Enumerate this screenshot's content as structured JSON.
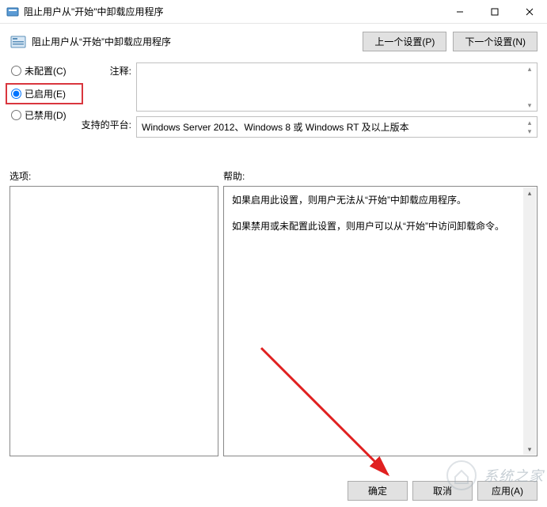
{
  "window": {
    "title": "阻止用户从\"开始\"中卸载应用程序"
  },
  "header": {
    "title": "阻止用户从“开始”中卸载应用程序",
    "prev_btn": "上一个设置(P)",
    "next_btn": "下一个设置(N)"
  },
  "radios": {
    "not_configured": "未配置(C)",
    "enabled": "已启用(E)",
    "disabled": "已禁用(D)"
  },
  "fields": {
    "comment_label": "注释:",
    "comment_value": "",
    "platform_label": "支持的平台:",
    "platform_value": "Windows Server 2012、Windows 8 或 Windows RT 及以上版本"
  },
  "lower": {
    "options_label": "选项:",
    "help_label": "帮助:",
    "help_text_1": "如果启用此设置，则用户无法从“开始”中卸载应用程序。",
    "help_text_2": "如果禁用或未配置此设置，则用户可以从“开始”中访问卸载命令。"
  },
  "footer": {
    "ok": "确定",
    "cancel": "取消",
    "apply": "应用(A)"
  },
  "watermark": "系统之家"
}
